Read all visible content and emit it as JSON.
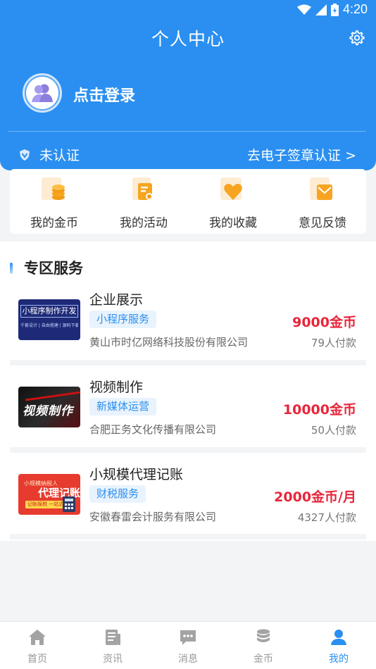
{
  "status_bar": {
    "time": "4:20"
  },
  "header": {
    "title": "个人中心",
    "login_text": "点击登录"
  },
  "certification": {
    "status": "未认证",
    "action": "去电子签章认证 >"
  },
  "quick_menu": [
    {
      "label": "我的金币",
      "icon": "coins-icon"
    },
    {
      "label": "我的活动",
      "icon": "activity-icon"
    },
    {
      "label": "我的收藏",
      "icon": "heart-icon"
    },
    {
      "label": "意见反馈",
      "icon": "feedback-icon"
    }
  ],
  "zone": {
    "title": "专区服务",
    "services": [
      {
        "name": "企业展示",
        "tag": "小程序服务",
        "company": "黄山市时亿网络科技股份有限公司",
        "price": "9000金币",
        "count": "79人付款",
        "thumb_title": "小程序制作开发",
        "thumb_sub": "千套设计 | 自由搭建 | 源码下载"
      },
      {
        "name": "视频制作",
        "tag": "新媒体运营",
        "company": "合肥正务文化传播有限公司",
        "price": "10000金币",
        "count": "50人付款",
        "thumb_title": "视频制作"
      },
      {
        "name": "小规模代理记账",
        "tag": "财税服务",
        "company": "安徽春雷会计服务有限公司",
        "price": "2000金币/月",
        "count": "4327人付款",
        "thumb_title": "代理记账",
        "thumb_sub": "小规模纳税人",
        "thumb_badge": "记账报税 一站式"
      }
    ]
  },
  "bottom_nav": [
    {
      "label": "首页",
      "icon": "home-icon"
    },
    {
      "label": "资讯",
      "icon": "news-icon"
    },
    {
      "label": "消息",
      "icon": "message-icon"
    },
    {
      "label": "金币",
      "icon": "coin-stack-icon"
    },
    {
      "label": "我的",
      "icon": "user-icon",
      "active": true
    }
  ],
  "colors": {
    "primary": "#2a8ff0",
    "price": "#e8263c",
    "accent_orange": "#f7a520"
  }
}
